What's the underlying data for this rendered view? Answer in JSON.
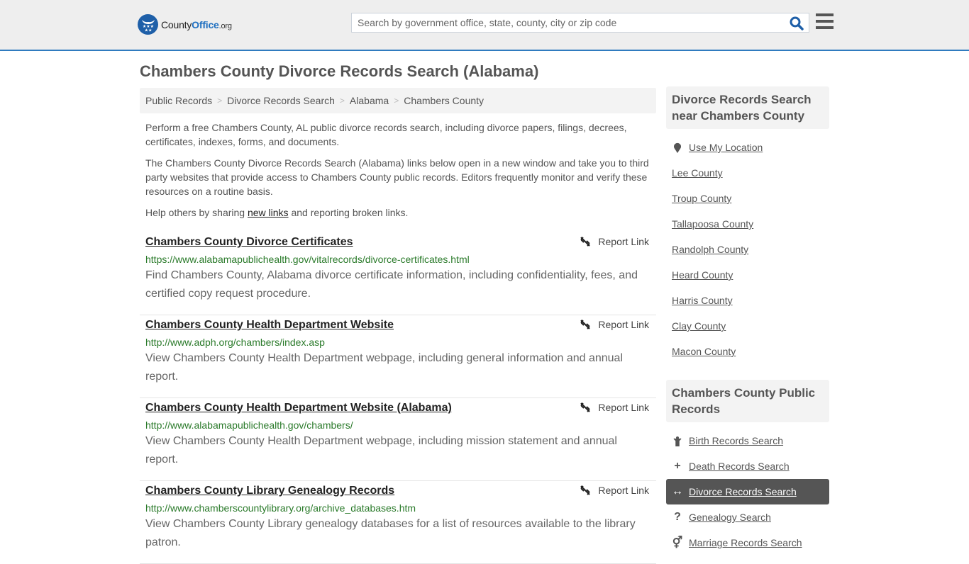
{
  "header": {
    "logo": {
      "name": "County",
      "accent": "Office",
      "tld": ".org"
    },
    "search": {
      "placeholder": "Search by government office, state, county, city or zip code",
      "value": ""
    },
    "icons": {
      "search": "search-icon",
      "menu": "hamburger-menu-icon"
    }
  },
  "page": {
    "title": "Chambers County Divorce Records Search (Alabama)"
  },
  "breadcrumb": [
    {
      "label": "Public Records"
    },
    {
      "label": "Divorce Records Search"
    },
    {
      "label": "Alabama"
    },
    {
      "label": "Chambers County"
    }
  ],
  "intro": {
    "p1": "Perform a free Chambers County, AL public divorce records search, including divorce papers, filings, decrees, certificates, indexes, forms, and documents.",
    "p2": "The Chambers County Divorce Records Search (Alabama) links below open in a new window and take you to third party websites that provide access to Chambers County public records. Editors frequently monitor and verify these resources on a routine basis.",
    "p3_before": "Help others by sharing ",
    "p3_link": "new links",
    "p3_after": " and reporting broken links."
  },
  "results": [
    {
      "title": "Chambers County Divorce Certificates",
      "url": "https://www.alabamapublichealth.gov/vitalrecords/divorce-certificates.html",
      "description": "Find Chambers County, Alabama divorce certificate information, including confidentiality, fees, and certified copy request procedure.",
      "report_label": "Report Link"
    },
    {
      "title": "Chambers County Health Department Website",
      "url": "http://www.adph.org/chambers/index.asp",
      "description": "View Chambers County Health Department webpage, including general information and annual report.",
      "report_label": "Report Link"
    },
    {
      "title": "Chambers County Health Department Website (Alabama)",
      "url": "http://www.alabamapublichealth.gov/chambers/",
      "description": "View Chambers County Health Department webpage, including mission statement and annual report.",
      "report_label": "Report Link"
    },
    {
      "title": "Chambers County Library Genealogy Records",
      "url": "http://www.chamberscountylibrary.org/archive_databases.htm",
      "description": "View Chambers County Library genealogy databases for a list of resources available to the library patron.",
      "report_label": "Report Link"
    }
  ],
  "sidebar": {
    "nearby": {
      "heading": "Divorce Records Search near Chambers County",
      "location_label": "Use My Location",
      "counties": [
        "Lee County",
        "Troup County",
        "Tallapoosa County",
        "Randolph County",
        "Heard County",
        "Harris County",
        "Clay County",
        "Macon County"
      ]
    },
    "public_records": {
      "heading": "Chambers County Public Records",
      "items": [
        {
          "label": "Birth Records Search",
          "icon": "child-icon",
          "glyph": "†",
          "active": false
        },
        {
          "label": "Death Records Search",
          "icon": "plus-icon",
          "glyph": "+",
          "active": false
        },
        {
          "label": "Divorce Records Search",
          "icon": "arrows-horizontal-icon",
          "glyph": "↔",
          "active": true
        },
        {
          "label": "Genealogy Search",
          "icon": "question-icon",
          "glyph": "?",
          "active": false
        },
        {
          "label": "Marriage Records Search",
          "icon": "venus-mars-icon",
          "glyph": "⚥",
          "active": false
        }
      ]
    }
  },
  "colors": {
    "brand_blue": "#1e5fa8",
    "header_border": "#2f7bbf",
    "url_green": "#2a7a2a",
    "active_bg": "#555555"
  }
}
